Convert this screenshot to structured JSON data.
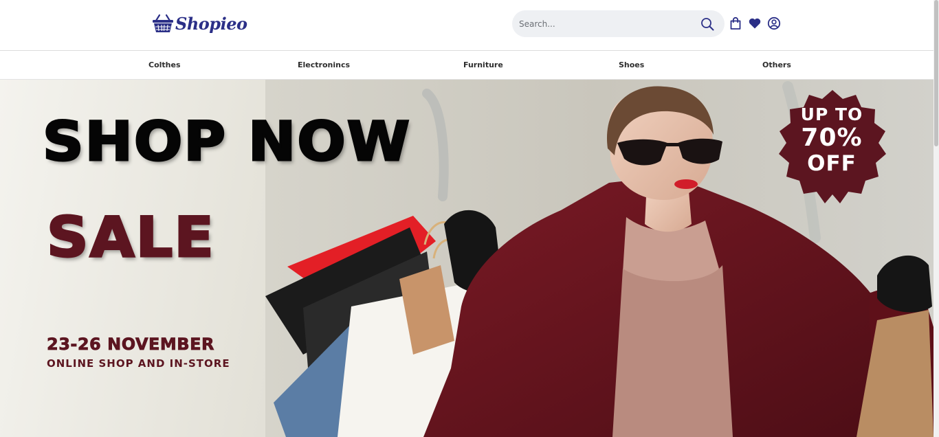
{
  "brand": {
    "name": "Shopieo",
    "color": "#2b2f87"
  },
  "header": {
    "search": {
      "placeholder": "Search...",
      "value": ""
    },
    "icons": [
      "search-icon",
      "shopping-bag-icon",
      "heart-icon",
      "user-icon"
    ]
  },
  "categories": [
    "Colthes",
    "Electronincs",
    "Furniture",
    "Shoes",
    "Others"
  ],
  "hero": {
    "headline": "SHOP NOW",
    "subheadline": "SALE",
    "dates": "23-26 NOVEMBER",
    "location": "ONLINE SHOP AND IN-STORE",
    "badge": {
      "line1": "UP TO",
      "line2": "70%",
      "line3": "OFF"
    },
    "colors": {
      "accent": "#5c1520",
      "headline": "#050505",
      "badge": "#5c1520"
    }
  }
}
